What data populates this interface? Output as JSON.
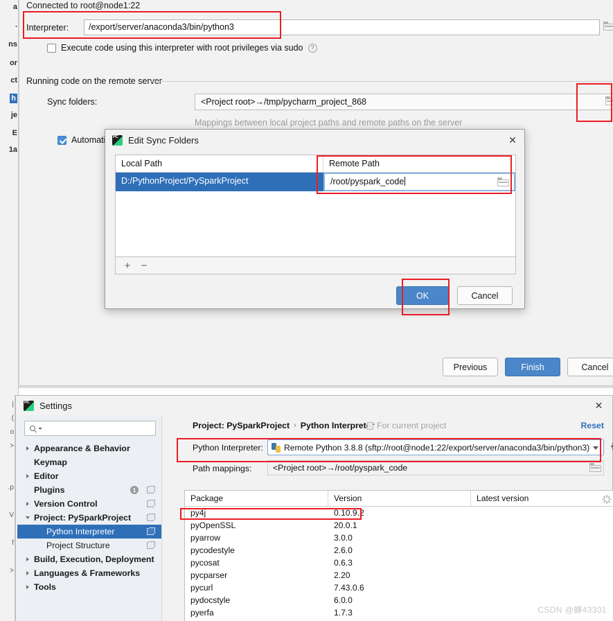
{
  "ide_sliver": {
    "fragments": [
      "a",
      ".",
      "ns",
      "or",
      "ct",
      "h",
      "je",
      "E",
      "1a"
    ],
    "fragments2": [
      "|",
      "(",
      "o",
      ">",
      ".p",
      "V",
      "f",
      ">"
    ]
  },
  "wizard": {
    "connected_label": "Connected to root@node1:22",
    "interpreter_label": "Interpreter:",
    "interpreter_value": "/export/server/anaconda3/bin/python3",
    "sudo_checkbox_label": "Execute code using this interpreter with root privileges via sudo",
    "help_glyph": "?",
    "group_title": "Running code on the remote server",
    "sync_label": "Sync folders:",
    "sync_value": "<Project root>→/tmp/pycharm_project_868",
    "mappings_hint": "Mappings between local project paths and remote paths on the server",
    "automatic_label": "Automatical",
    "buttons": {
      "previous": "Previous",
      "finish": "Finish",
      "cancel": "Cancel"
    }
  },
  "modal": {
    "title": "Edit Sync Folders",
    "close_glyph": "✕",
    "columns": [
      "Local Path",
      "Remote Path"
    ],
    "rows": [
      {
        "local": "D:/PythonProject/PySparkProject",
        "remote": "/root/pyspark_code"
      }
    ],
    "toolbar": {
      "add": "+",
      "remove": "−"
    },
    "buttons": {
      "ok": "OK",
      "cancel": "Cancel"
    }
  },
  "settings": {
    "title": "Settings",
    "close_glyph": "✕",
    "search_placeholder": "",
    "tree": [
      {
        "label": "Appearance & Behavior",
        "twisty": "right",
        "bold": true,
        "indent": false,
        "selected": false,
        "badge": null,
        "copy": false
      },
      {
        "label": "Keymap",
        "twisty": "none",
        "bold": true,
        "indent": false,
        "selected": false,
        "badge": null,
        "copy": false
      },
      {
        "label": "Editor",
        "twisty": "right",
        "bold": true,
        "indent": false,
        "selected": false,
        "badge": null,
        "copy": false
      },
      {
        "label": "Plugins",
        "twisty": "none",
        "bold": true,
        "indent": false,
        "selected": false,
        "badge": "1",
        "copy": true
      },
      {
        "label": "Version Control",
        "twisty": "right",
        "bold": true,
        "indent": false,
        "selected": false,
        "badge": null,
        "copy": true
      },
      {
        "label": "Project: PySparkProject",
        "twisty": "down",
        "bold": true,
        "indent": false,
        "selected": false,
        "badge": null,
        "copy": true
      },
      {
        "label": "Python Interpreter",
        "twisty": "none",
        "bold": false,
        "indent": true,
        "selected": true,
        "badge": null,
        "copy": true
      },
      {
        "label": "Project Structure",
        "twisty": "none",
        "bold": false,
        "indent": true,
        "selected": false,
        "badge": null,
        "copy": true
      },
      {
        "label": "Build, Execution, Deployment",
        "twisty": "right",
        "bold": true,
        "indent": false,
        "selected": false,
        "badge": null,
        "copy": false
      },
      {
        "label": "Languages & Frameworks",
        "twisty": "right",
        "bold": true,
        "indent": false,
        "selected": false,
        "badge": null,
        "copy": false
      },
      {
        "label": "Tools",
        "twisty": "right",
        "bold": true,
        "indent": false,
        "selected": false,
        "badge": null,
        "copy": false
      }
    ],
    "breadcrumb": {
      "project": "Project: PySparkProject",
      "separator": "›",
      "page": "Python Interpreter"
    },
    "for_current_project": "For current project",
    "reset_link": "Reset",
    "python_interpreter_label": "Python Interpreter:",
    "python_interpreter_value": "Remote Python 3.8.8 (sftp://root@node1:22/export/server/anaconda3/bin/python3)",
    "path_mappings_label": "Path mappings:",
    "path_mappings_value": "<Project root>→/root/pyspark_code",
    "packages": {
      "columns": [
        "Package",
        "Version",
        "Latest version"
      ],
      "rows": [
        {
          "name": "py4j",
          "version": "0.10.9.2",
          "latest": ""
        },
        {
          "name": "pyOpenSSL",
          "version": "20.0.1",
          "latest": ""
        },
        {
          "name": "pyarrow",
          "version": "3.0.0",
          "latest": ""
        },
        {
          "name": "pycodestyle",
          "version": "2.6.0",
          "latest": ""
        },
        {
          "name": "pycosat",
          "version": "0.6.3",
          "latest": ""
        },
        {
          "name": "pycparser",
          "version": "2.20",
          "latest": ""
        },
        {
          "name": "pycurl",
          "version": "7.43.0.6",
          "latest": ""
        },
        {
          "name": "pydocstyle",
          "version": "6.0.0",
          "latest": ""
        },
        {
          "name": "pyerfa",
          "version": "1.7.3",
          "latest": ""
        }
      ]
    }
  },
  "watermark": "CSDN @蝉43301",
  "colors": {
    "accent_blue": "#2f6fb8",
    "primary_button": "#4a86c8",
    "annotation_red": "#ec1c24",
    "link_blue": "#2f6fb8"
  }
}
